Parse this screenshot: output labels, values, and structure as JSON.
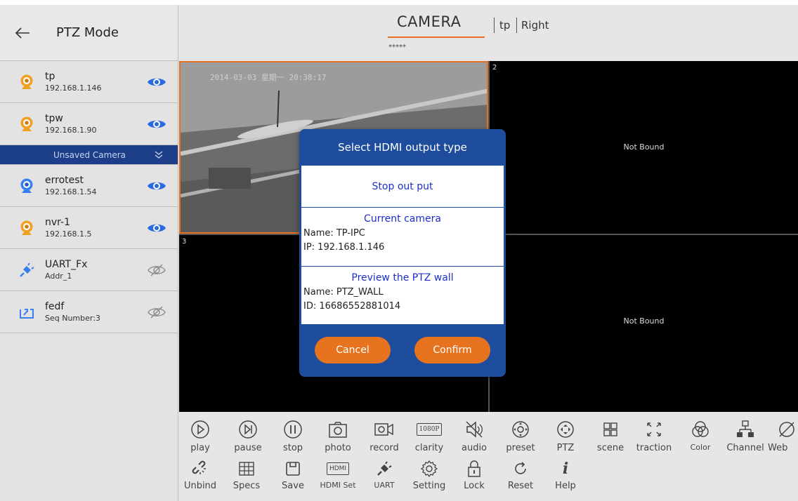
{
  "colors": {
    "accent": "#e87124",
    "dialog_blue": "#1e4d9e",
    "option_text": "#1d2fc6",
    "unsaved_bg": "#1d3f8a"
  },
  "left_panel": {
    "title": "PTZ Mode",
    "cameras": [
      {
        "name": "tp",
        "sub": "192.168.1.146",
        "icon": "webcam-icon",
        "visible": true
      },
      {
        "name": "tpw",
        "sub": "192.168.1.90",
        "icon": "webcam-icon",
        "visible": true
      }
    ],
    "unsaved_label": "Unsaved Camera",
    "unsaved_cameras": [
      {
        "name": "errotest",
        "sub": "192.168.1.54",
        "icon": "webcam-icon",
        "visible": true
      },
      {
        "name": "nvr-1",
        "sub": "192.168.1.5",
        "icon": "webcam-icon",
        "visible": true
      },
      {
        "name": "UART_Fx",
        "sub": "Addr_1",
        "icon": "uart-plug-icon",
        "visible": false
      },
      {
        "name": "fedf",
        "sub": "Seq Number:3",
        "icon": "sequence-icon",
        "visible": false
      }
    ]
  },
  "header": {
    "title": "CAMERA",
    "stars": "*****",
    "selected": "tp",
    "position": "Right"
  },
  "grid": {
    "cell1_timestamp": "2014-03-03 星期一 20:38:17",
    "cell2_number": "2",
    "cell3_number": "3",
    "not_bound": "Not Bound"
  },
  "toolbar": {
    "row1": [
      "play",
      "pause",
      "stop",
      "photo",
      "record",
      "clarity",
      "audio",
      "preset",
      "PTZ",
      "scene",
      "traction",
      "Color",
      "Channel",
      "Web"
    ],
    "row2": [
      "Unbind",
      "Specs",
      "Save",
      "HDMI Set",
      "UART",
      "Setting",
      "Lock",
      "Reset",
      "Help"
    ],
    "clarity_badge": "1080P",
    "hdmi_badge": "HDMI"
  },
  "dialog": {
    "title": "Select HDMI output type",
    "stop_output": "Stop out put",
    "current_camera": {
      "heading": "Current camera",
      "name": "Name: TP-IPC",
      "ip": "IP: 192.168.1.146"
    },
    "ptz_wall": {
      "heading": "Preview the PTZ wall",
      "name": "Name: PTZ_WALL",
      "id": "ID: 16686552881014"
    },
    "cancel": "Cancel",
    "confirm": "Confirm"
  }
}
